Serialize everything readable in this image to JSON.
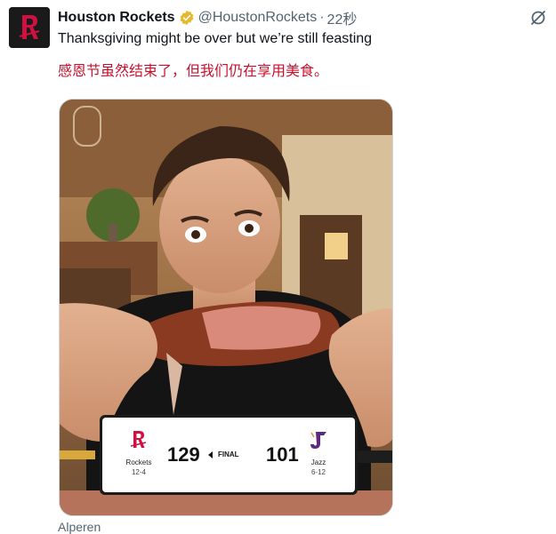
{
  "tweet": {
    "author_name": "Houston Rockets",
    "handle": "@HoustonRockets",
    "separator": "·",
    "timestamp": "22秒",
    "text_en": "Thanksgiving might be over but we’re still feasting",
    "text_zh": "感恩节虽然结束了，但我们仍在享用美食。",
    "media_caption": "Alperen"
  },
  "scorecard": {
    "home": {
      "name": "Rockets",
      "record": "12-4",
      "score": "129"
    },
    "away": {
      "name": "Jazz",
      "record": "6-12",
      "score": "101"
    },
    "status": "FINAL"
  },
  "colors": {
    "rockets_red": "#ce1141",
    "jazz_purple": "#5b2b82",
    "verified_gold": "#e8b829",
    "translation_red": "#c8102e"
  },
  "icons": {
    "verified": "verified-badge-icon",
    "grok": "grok-icon",
    "final_arrow": "triangle-left-icon"
  }
}
